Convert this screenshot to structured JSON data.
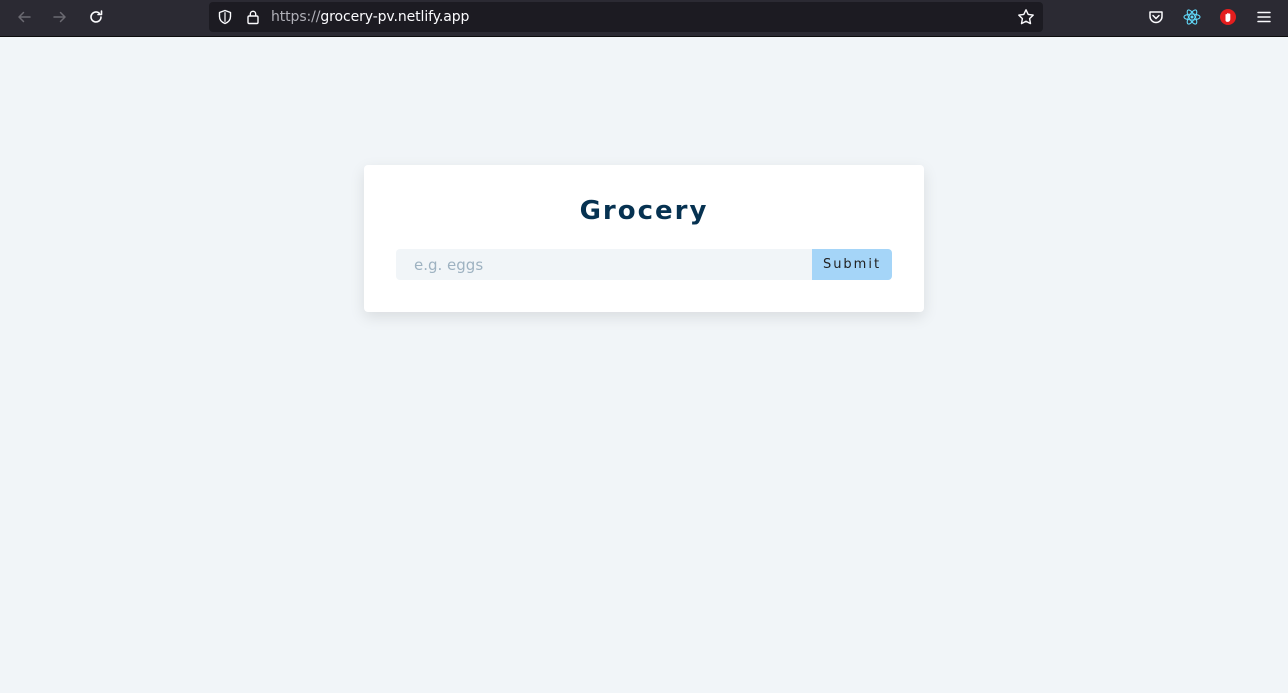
{
  "browser": {
    "url_scheme": "https://",
    "url_host": "grocery-pv.netlify.app",
    "icons": {
      "back": "back-arrow-icon",
      "forward": "forward-arrow-icon",
      "reload": "reload-icon",
      "tracking": "shield-icon",
      "lock": "lock-icon",
      "bookmark": "star-icon",
      "pocket": "pocket-icon",
      "react_devtools": "react-icon",
      "ublock": "ublock-icon",
      "menu": "hamburger-menu-icon"
    },
    "colors": {
      "toolbar_bg": "#2b2a33",
      "urlbar_bg": "#1c1b22"
    }
  },
  "app": {
    "title": "Grocery",
    "input": {
      "value": "",
      "placeholder": "e.g. eggs"
    },
    "submit_label": "Submit",
    "colors": {
      "page_bg": "#f1f5f8",
      "title": "#063251",
      "submit_bg": "#a5d5f8"
    }
  }
}
